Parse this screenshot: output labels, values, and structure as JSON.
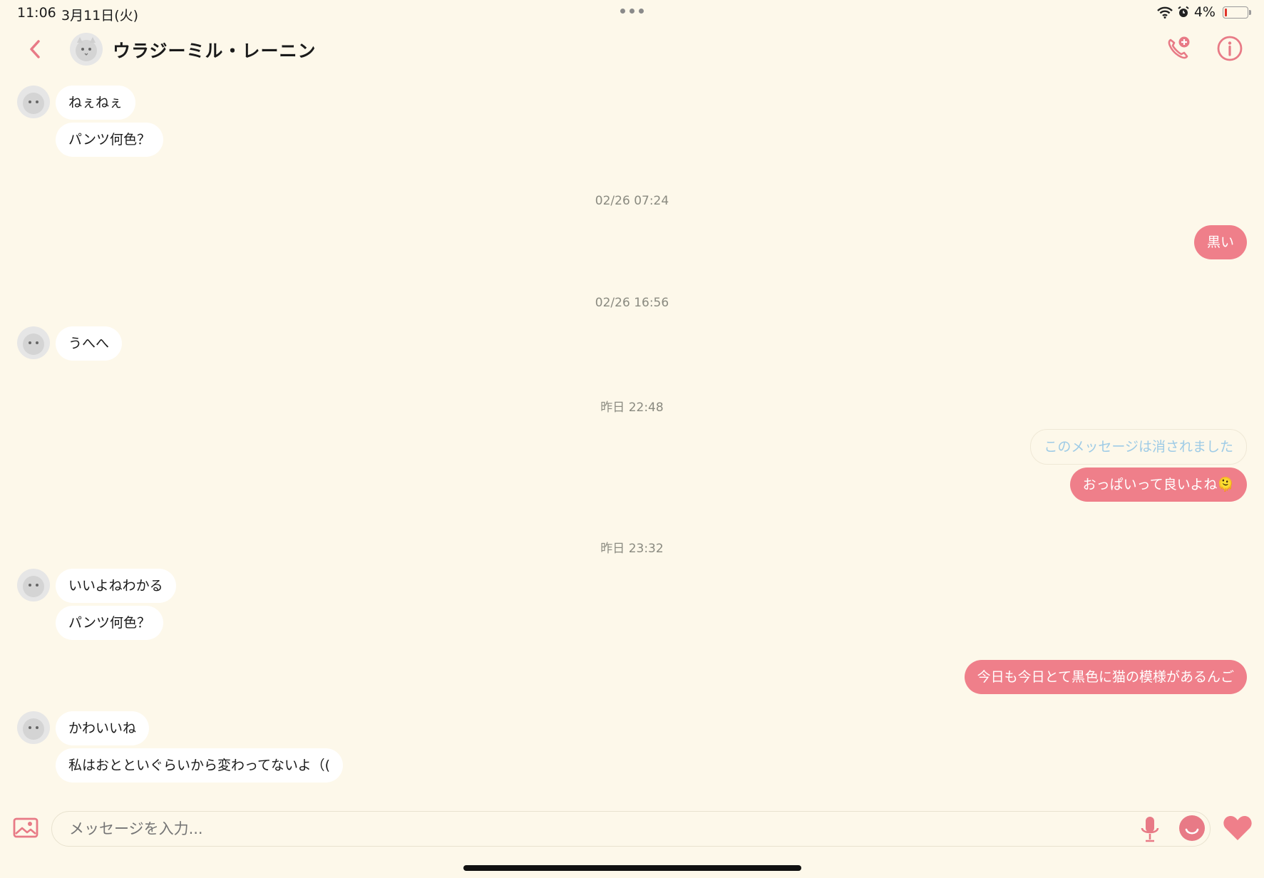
{
  "status_bar": {
    "time": "11:06",
    "date": "3月11日(火)",
    "battery": "4%"
  },
  "header": {
    "contact_name": "ウラジーミル・レーニン"
  },
  "messages": {
    "m1": "ねぇねぇ",
    "m2": "パンツ何色？",
    "ts1": "02/26 07:24",
    "m3": "黒い",
    "ts2": "02/26 16:56",
    "m4": "うへへ",
    "ts3": "昨日 22:48",
    "m5": "このメッセージは消されました",
    "m6": "おっぱいって良いよね🫠",
    "ts4": "昨日 23:32",
    "m7": "いいよねわかる",
    "m8": "パンツ何色？",
    "m9": "今日も今日とて黒色に猫の模様があるんご",
    "m10": "かわいいね",
    "m11": "私はおとといぐらいから変わってないよ（("
  },
  "input": {
    "placeholder": "メッセージを入力..."
  },
  "colors": {
    "background": "#fdf8ea",
    "accent": "#ef7f8a",
    "incoming_bubble": "#ffffff"
  }
}
